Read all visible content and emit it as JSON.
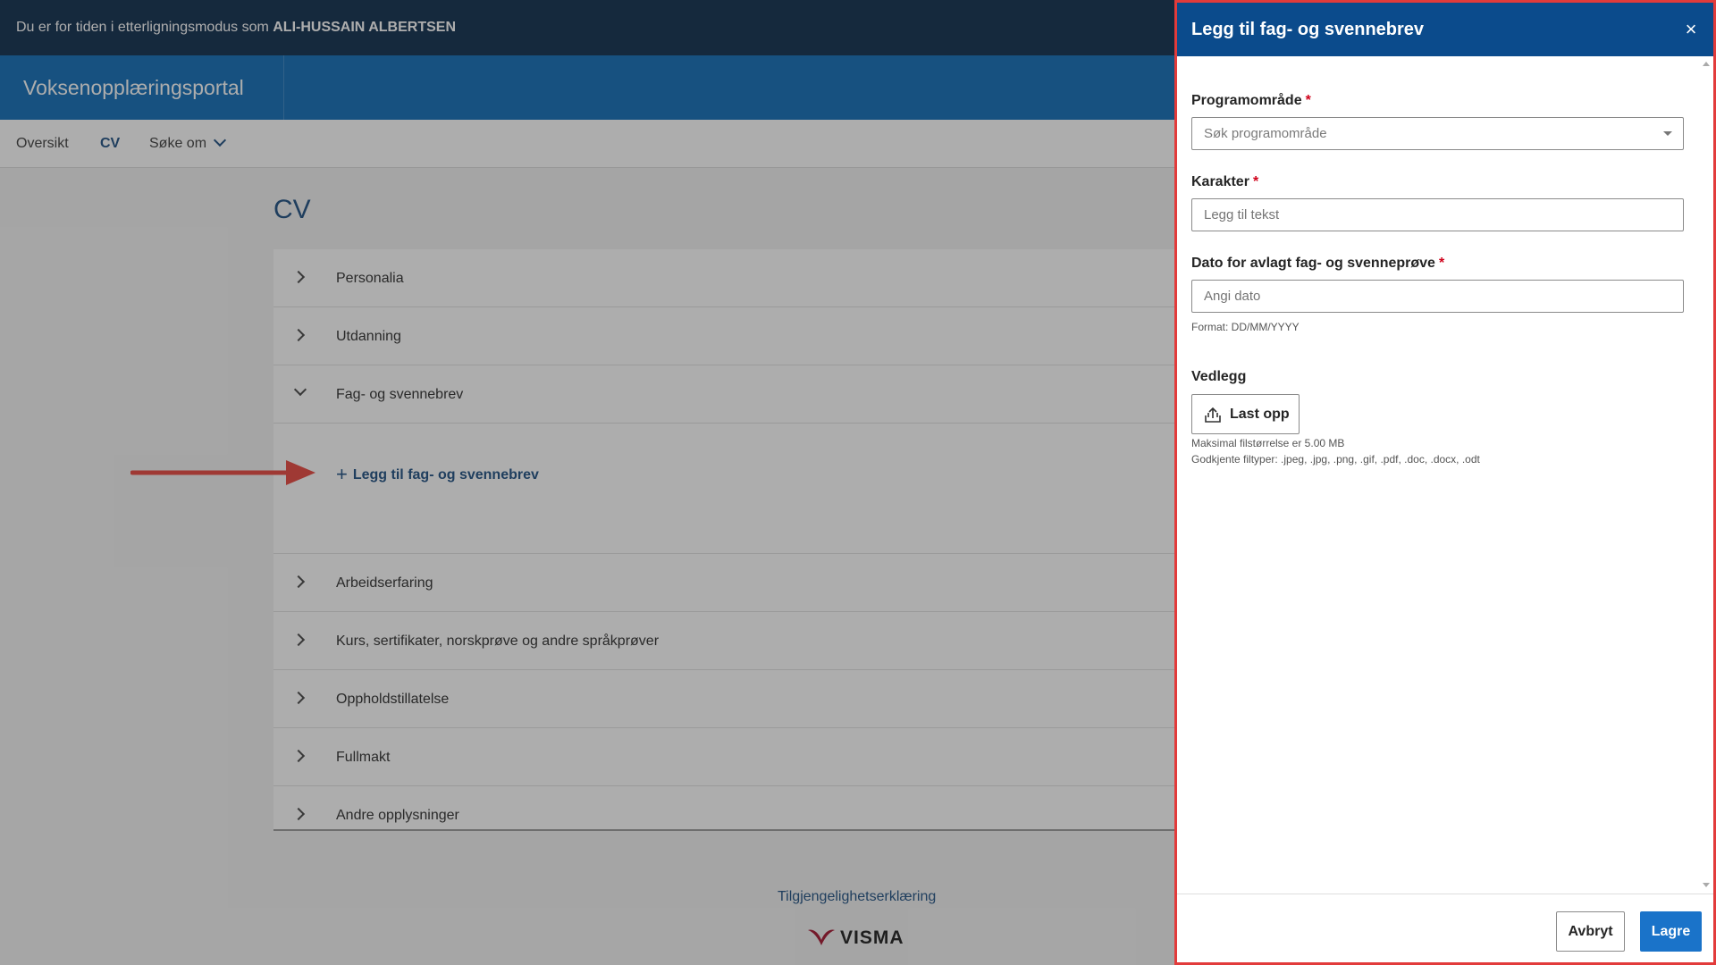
{
  "impersonation": {
    "prefix": "Du er for tiden i etterligningsmodus som",
    "user": "ALI-HUSSAIN ALBERTSEN"
  },
  "app": {
    "title": "Voksenopplæringsportal"
  },
  "nav": {
    "items": [
      {
        "label": "Oversikt"
      },
      {
        "label": "CV"
      },
      {
        "label": "Søke om"
      }
    ]
  },
  "page": {
    "title": "CV"
  },
  "accordion": {
    "sections": [
      {
        "label": "Personalia",
        "expanded": false
      },
      {
        "label": "Utdanning",
        "expanded": false
      },
      {
        "label": "Fag- og svennebrev",
        "expanded": true
      },
      {
        "label": "Arbeidserfaring",
        "expanded": false
      },
      {
        "label": "Kurs, sertifikater, norskprøve og andre språkprøver",
        "expanded": false
      },
      {
        "label": "Oppholdstillatelse",
        "expanded": false
      },
      {
        "label": "Fullmakt",
        "expanded": false
      },
      {
        "label": "Andre opplysninger",
        "expanded": false
      }
    ],
    "add_link": {
      "icon": "+",
      "label": "Legg til fag- og svennebrev"
    }
  },
  "footer": {
    "link": "Tilgjengelighetserklæring",
    "logo": "VISMA"
  },
  "panel": {
    "title": "Legg til fag- og svennebrev",
    "close_icon": "×",
    "required_marker": "*",
    "fields": {
      "program_area": {
        "label": "Programområde",
        "placeholder": "Søk programområde"
      },
      "grade": {
        "label": "Karakter",
        "placeholder": "Legg til tekst"
      },
      "date": {
        "label": "Dato for avlagt fag- og svenneprøve",
        "placeholder": "Angi dato",
        "hint": "Format: DD/MM/YYYY"
      }
    },
    "attachments": {
      "label": "Vedlegg",
      "upload_label": "Last opp",
      "max_size": "Maksimal filstørrelse er 5.00 MB",
      "file_types": "Godkjente filtyper: .jpeg, .jpg, .png, .gif, .pdf, .doc, .docx, .odt"
    },
    "buttons": {
      "cancel": "Avbryt",
      "save": "Lagre"
    }
  },
  "colors": {
    "impersonation_bg": "#0b2a4b",
    "brand_bg": "#0d6bb6",
    "panel_header_bg": "#0b4b8c",
    "link": "#1b4d80",
    "primary_button": "#1a73c9",
    "required": "#d0021b",
    "highlight_border": "#e23b3b",
    "arrow": "#e8453c",
    "visma_logo": "#a3112c"
  }
}
